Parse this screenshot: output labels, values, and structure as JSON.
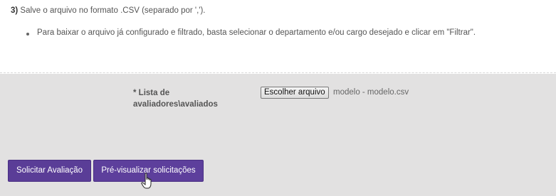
{
  "instructions": {
    "step_number": "3)",
    "step_text": " Salve o arquivo no formato .CSV (separado por ',').",
    "bullet_text": "Para baixar o arquivo já configurado e filtrado, basta selecionar o departamento e/ou cargo desejado e clicar em \"Filtrar\"."
  },
  "upload": {
    "label_line1": "* Lista de",
    "label_line2": "avaliadores\\avaliados",
    "choose_button": "Escolher arquivo",
    "file_name": "modelo - modelo.csv"
  },
  "actions": {
    "request_label": "Solicitar Avaliação",
    "preview_label": "Pré-visualizar solicitações"
  },
  "colors": {
    "accent": "#5a3d97",
    "background": "#e2e1e1"
  },
  "icons": {
    "cursor": "hand-pointer-icon"
  }
}
